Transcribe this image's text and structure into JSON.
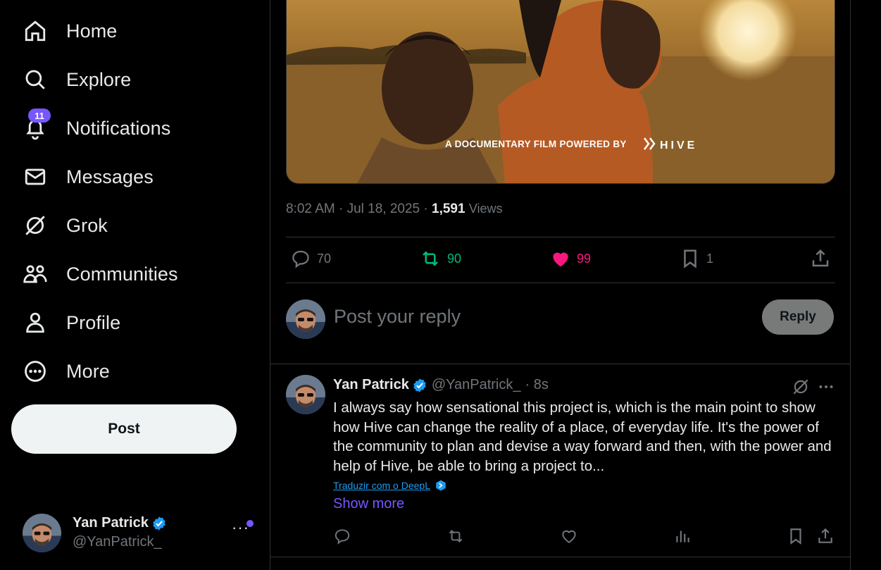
{
  "nav": {
    "items": [
      {
        "label": "Home",
        "icon": "home-icon"
      },
      {
        "label": "Explore",
        "icon": "search-icon"
      },
      {
        "label": "Notifications",
        "icon": "bell-icon",
        "badge": "11"
      },
      {
        "label": "Messages",
        "icon": "envelope-icon"
      },
      {
        "label": "Grok",
        "icon": "grok-icon"
      },
      {
        "label": "Communities",
        "icon": "people-icon"
      },
      {
        "label": "Profile",
        "icon": "person-icon"
      },
      {
        "label": "More",
        "icon": "more-circle-icon"
      }
    ],
    "post_button": "Post"
  },
  "account": {
    "name": "Yan Patrick",
    "handle": "@YanPatrick_",
    "more": "···"
  },
  "tweet": {
    "media_caption": "A DOCUMENTARY FILM POWERED BY",
    "media_brand": "HIVE",
    "time": "8:02 AM · Jul 18, 2025 · ",
    "views": "1,591",
    "views_label": "Views",
    "replies": "70",
    "reposts": "90",
    "likes": "99",
    "bookmarks": "1"
  },
  "reply_composer": {
    "placeholder": "Post your reply",
    "button": "Reply"
  },
  "reply": {
    "name": "Yan Patrick",
    "handle": "@YanPatrick_",
    "time": "· 8s",
    "text": "I always say how sensational this project is, which is the main point to show how Hive can change the reality of a place, of everyday life. It's the power of the community to plan and devise a way forward and then, with the power and help of Hive, be able to bring a project to...",
    "translate": "Traduzir com o DeepL",
    "show_more": "Show more"
  },
  "colors": {
    "background": "#000000",
    "accent": "#7856ff",
    "like": "#f91880",
    "repost": "#00ba7c",
    "verified": "#1d9bf0"
  }
}
